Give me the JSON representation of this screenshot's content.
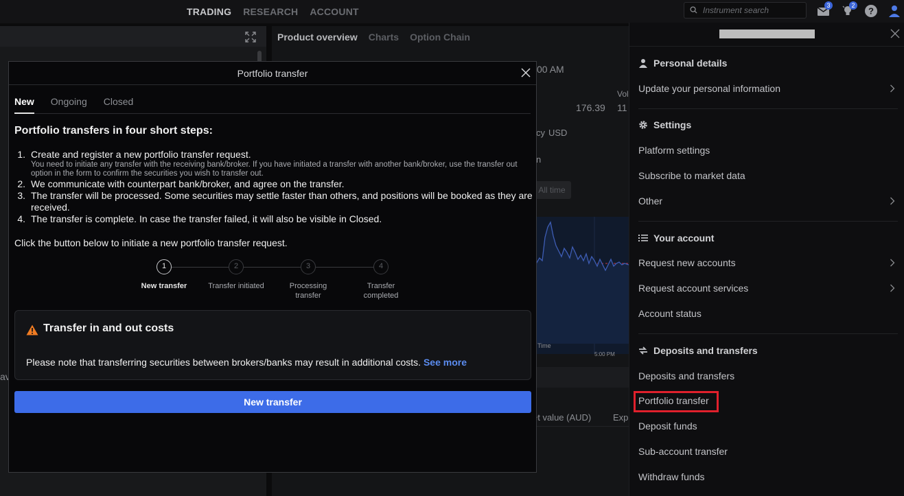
{
  "topnav": {
    "links": [
      "TRADING",
      "RESEARCH",
      "ACCOUNT"
    ],
    "active": "TRADING",
    "search_placeholder": "Instrument search",
    "mail_badge": "3",
    "notify_badge": "2"
  },
  "background": {
    "tabs": [
      "Product overview",
      "Charts",
      "Option Chain"
    ],
    "active_tab": "Product overview",
    "time": "00 AM",
    "price": "176.39",
    "vol_label": "Vol",
    "vol_value": "11",
    "currency_label": "cy",
    "currency": "USD",
    "period": "All time",
    "chart_x_label": "Time",
    "chart_time": "5:00 PM",
    "market_value": "et value (AUD)",
    "exp": "Exp",
    "partial_n": "n",
    "partial_ave": "ave"
  },
  "modal": {
    "title": "Portfolio transfer",
    "tabs": [
      "New",
      "Ongoing",
      "Closed"
    ],
    "active_tab": "New",
    "heading": "Portfolio transfers in four short steps:",
    "steps": [
      {
        "num": "1.",
        "text": "Create and register a new portfolio transfer request.",
        "sub": "You need to initiate any transfer with the receiving bank/broker. If you have initiated a transfer with another bank/broker, use the transfer out option in the form to confirm the securities you wish to transfer out."
      },
      {
        "num": "2.",
        "text": "We communicate with counterpart bank/broker, and agree on the transfer."
      },
      {
        "num": "3.",
        "text": "The transfer will be processed. Some securities may settle faster than others, and positions will be booked as they are received."
      },
      {
        "num": "4.",
        "text": "The transfer is complete. In case the transfer failed, it will also be visible in Closed."
      }
    ],
    "intro": "Click the button below to initiate a new portfolio transfer request.",
    "stepper": [
      {
        "num": "1",
        "label": "New transfer"
      },
      {
        "num": "2",
        "label": "Transfer initiated"
      },
      {
        "num": "3",
        "label": "Processing transfer"
      },
      {
        "num": "4",
        "label": "Transfer completed"
      }
    ],
    "active_step": 0,
    "cost_title": "Transfer in and out costs",
    "cost_body": "Please note that transferring securities between brokers/banks may result in additional costs.",
    "cost_link": "See more",
    "button": "New transfer"
  },
  "panel": {
    "sections": {
      "personal": "Personal details",
      "settings": "Settings",
      "account": "Your account",
      "deposits": "Deposits and transfers"
    },
    "items": {
      "update_info": "Update your personal information",
      "platform_settings": "Platform settings",
      "subscribe": "Subscribe to market data",
      "other": "Other",
      "request_accounts": "Request new accounts",
      "request_services": "Request account services",
      "account_status": "Account status",
      "deposits_transfers": "Deposits and transfers",
      "portfolio_transfer": "Portfolio transfer",
      "deposit_funds": "Deposit funds",
      "subaccount_transfer": "Sub-account transfer",
      "withdraw_funds": "Withdraw funds"
    }
  },
  "colors": {
    "accent": "#3d6ce8",
    "link": "#5b8cf0",
    "warning": "#f07c23",
    "highlight": "#e0202c"
  }
}
